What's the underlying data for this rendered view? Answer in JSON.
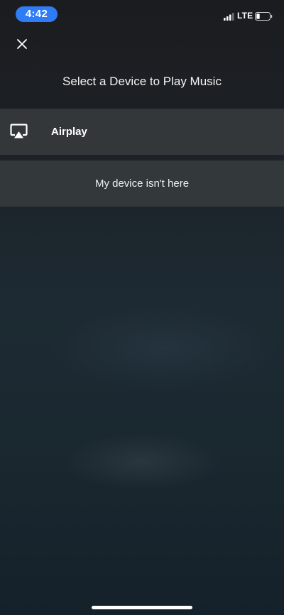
{
  "status_bar": {
    "time": "4:42",
    "network": "LTE",
    "signal_icon": "cellular-signal-icon",
    "battery_icon": "battery-low-icon",
    "time_pill_color": "#2f7cf6"
  },
  "close_icon": "close-icon",
  "title": "Select a Device to Play Music",
  "devices": [
    {
      "label": "Airplay",
      "icon": "airplay-icon"
    }
  ],
  "missing_device_label": "My device isn't here"
}
